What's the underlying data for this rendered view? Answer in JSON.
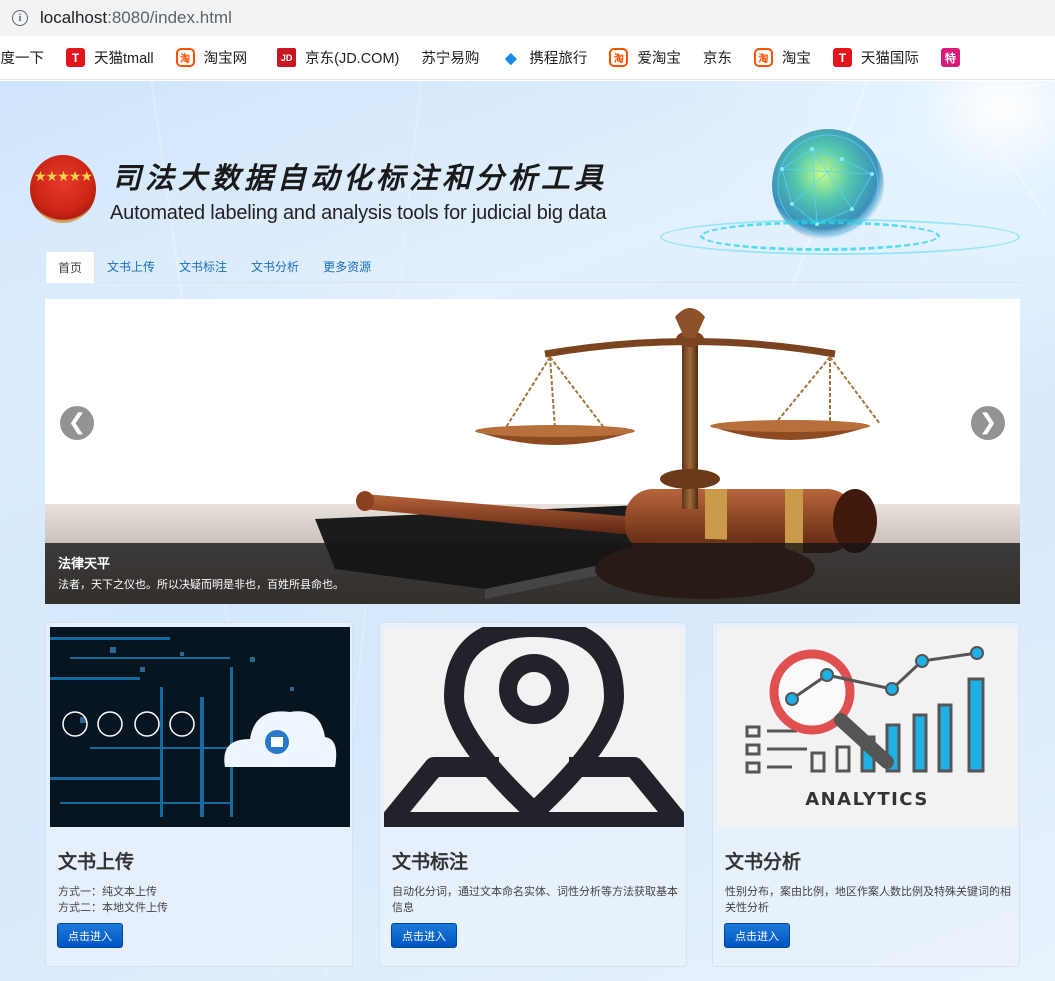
{
  "browser": {
    "url_host": "localhost",
    "url_rest": ":8080/index.html",
    "bookmarks": [
      {
        "label": "百度一下",
        "icon": "none"
      },
      {
        "label": "天猫tmall",
        "icon": "tmall-icon",
        "glyph": "T"
      },
      {
        "label": "淘宝网",
        "icon": "taobao-icon",
        "glyph": "淘"
      },
      {
        "label": "京东(JD.COM)",
        "icon": "jd-icon",
        "glyph": "JD"
      },
      {
        "label": "苏宁易购",
        "icon": "globe-icon",
        "glyph": "◉"
      },
      {
        "label": "携程旅行",
        "icon": "ctrip-icon",
        "glyph": "◆"
      },
      {
        "label": "爱淘宝",
        "icon": "taobao-icon",
        "glyph": "淘"
      },
      {
        "label": "京东",
        "icon": "globe-icon",
        "glyph": "◉"
      },
      {
        "label": "淘宝",
        "icon": "taobao-icon",
        "glyph": "淘"
      },
      {
        "label": "天猫国际",
        "icon": "tmall-icon",
        "glyph": "T"
      },
      {
        "label": "",
        "icon": "special-icon",
        "glyph": "特"
      }
    ]
  },
  "header": {
    "title_cn": "司法大数据自动化标注和分析工具",
    "title_en": "Automated labeling and analysis tools for judicial big data",
    "emblem_stars": "★★★★★"
  },
  "nav": {
    "tabs": [
      "首页",
      "文书上传",
      "文书标注",
      "文书分析",
      "更多资源"
    ],
    "active": 0
  },
  "carousel": {
    "prev_label": "❮",
    "next_label": "❯",
    "caption_title": "法律天平",
    "caption_text": "法者，天下之仪也。所以决疑而明是非也，百姓所县命也。"
  },
  "cards": [
    {
      "title": "文书上传",
      "desc": "方式一：纯文本上传\n方式二：本地文件上传",
      "button": "点击进入",
      "image": "cloud-upload-image"
    },
    {
      "title": "文书标注",
      "desc": "自动化分词，通过文本命名实体、词性分析等方法获取基本信息",
      "button": "点击进入",
      "image": "location-pin-image"
    },
    {
      "title": "文书分析",
      "desc": "性别分布，案由比例，地区作案人数比例及特殊关键词的相关性分析",
      "button": "点击进入",
      "image": "analytics-image",
      "image_text": "ANALYTICS"
    }
  ],
  "colors": {
    "accent": "#0054c4",
    "link": "#1a6fb5"
  }
}
